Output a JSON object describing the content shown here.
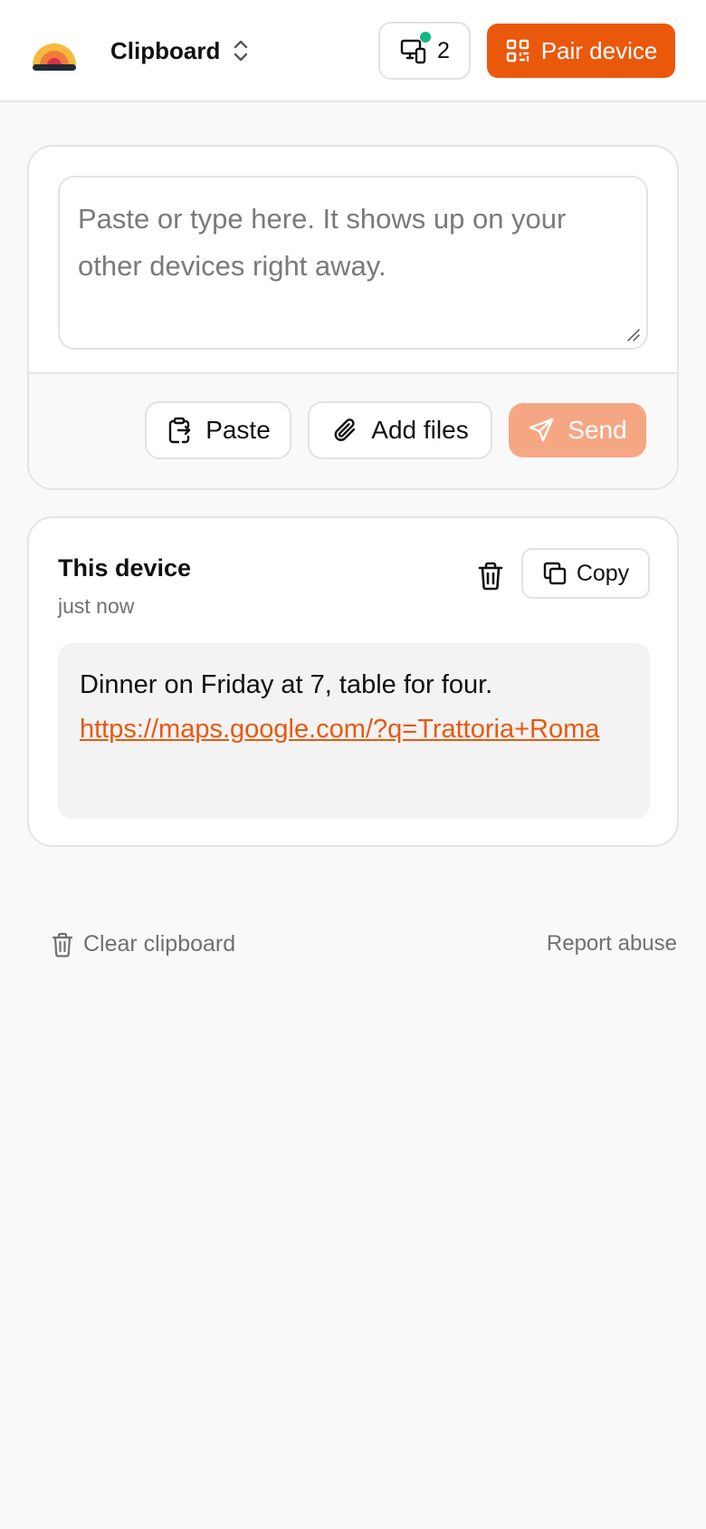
{
  "header": {
    "app_name": "Clipboard",
    "devices_count": "2",
    "pair_button": "Pair device"
  },
  "composer": {
    "placeholder": "Paste or type here. It shows up on your other devices right away.",
    "paste_label": "Paste",
    "add_files_label": "Add files",
    "send_label": "Send"
  },
  "clip": {
    "device": "This device",
    "time": "just now",
    "copy_label": "Copy",
    "text": "Dinner on Friday at 7, table for four.",
    "link": "https://maps.google.com/?q=Trattoria+Roma"
  },
  "footer": {
    "clear_label": "Clear clipboard",
    "report_label": "Report abuse"
  },
  "colors": {
    "accent": "#ea580c",
    "accent_disabled": "#f5a784",
    "online": "#12b886"
  }
}
